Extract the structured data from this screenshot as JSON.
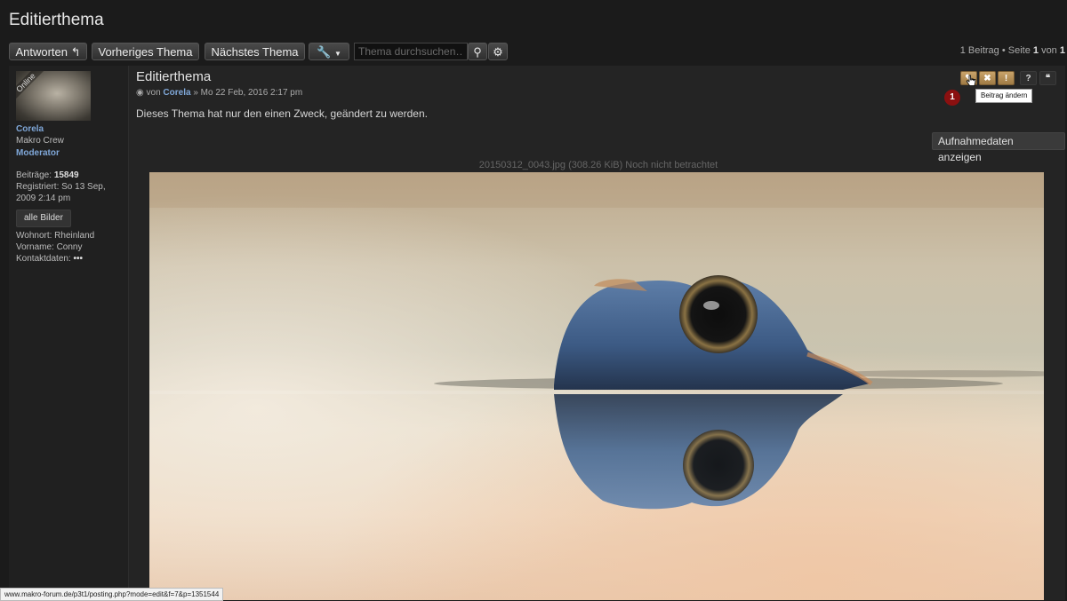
{
  "page": {
    "title": "Editierthema"
  },
  "toolbar": {
    "reply_label": "Antworten",
    "prev_label": "Vorheriges Thema",
    "next_label": "Nächstes Thema",
    "search_placeholder": "Thema durchsuchen…",
    "pager": {
      "prefix": "1 Beitrag • Seite",
      "current": "1",
      "of": "von",
      "total": "1"
    }
  },
  "profile": {
    "online_label": "Online",
    "username": "Corela",
    "rank": "Makro Crew",
    "role": "Moderator",
    "posts_label": "Beiträge:",
    "posts_value": "15849",
    "registered_line1": "Registriert: So 13 Sep,",
    "registered_line2": "2009 2:14 pm",
    "all_pictures_label": "alle Bilder",
    "location": "Wohnort: Rheinland",
    "first_name": "Vorname: Conny",
    "contact_label": "Kontaktdaten:",
    "contact_more": "•••"
  },
  "post": {
    "title": "Editierthema",
    "meta_by": "von",
    "meta_author": "Corela",
    "meta_date": "» Mo 22 Feb, 2016 2:17 pm",
    "body": "Dieses Thema hat nur den einen Zweck, geändert zu werden.",
    "action_buttons": [
      {
        "icon": "edit-icon",
        "glyph": "✎"
      },
      {
        "icon": "delete-icon",
        "glyph": "✖"
      },
      {
        "icon": "info-icon",
        "glyph": "!"
      },
      {
        "icon": "help-icon",
        "glyph": "?"
      },
      {
        "icon": "quote-icon",
        "glyph": "❝"
      }
    ],
    "tooltip": "Beitrag ändern",
    "callout_number": "1",
    "exif_button": "Aufnahmedaten anzeigen",
    "attachment_caption": "20150312_0043.jpg (308.26 KiB) Noch nicht betrachtet"
  },
  "status_bar": {
    "url": "www.makro-forum.de/p3t1/posting.php?mode=edit&f=7&p=1351544"
  }
}
